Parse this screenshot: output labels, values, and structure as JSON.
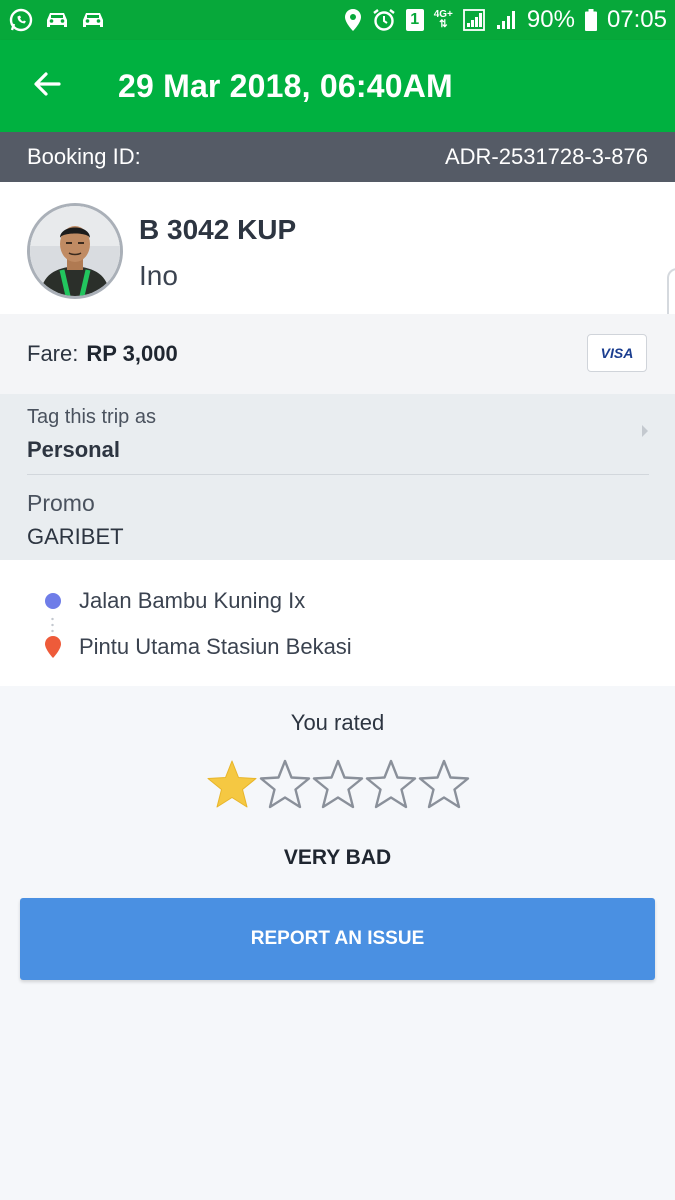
{
  "status_bar": {
    "battery": "90%",
    "time": "07:05",
    "sim_badge": "1",
    "network": "4G+"
  },
  "header": {
    "title": "29 Mar 2018, 06:40AM"
  },
  "booking": {
    "label": "Booking ID:",
    "id": "ADR-2531728-3-876"
  },
  "driver": {
    "plate": "B 3042 KUP",
    "name": "Ino"
  },
  "fare": {
    "label": "Fare:",
    "value": "RP 3,000",
    "card": "VISA"
  },
  "tag": {
    "label": "Tag this trip as",
    "value": "Personal"
  },
  "promo": {
    "label": "Promo",
    "value": "GARIBET"
  },
  "route": {
    "from": "Jalan Bambu Kuning Ix",
    "to": "Pintu Utama Stasiun Bekasi"
  },
  "rating": {
    "label": "You rated",
    "stars_filled": 1,
    "stars_total": 5,
    "verdict": "VERY BAD"
  },
  "actions": {
    "report": "REPORT AN ISSUE"
  },
  "colors": {
    "brand_green": "#00b140",
    "status_green": "#07a83a",
    "star_filled": "#f5c842",
    "button_blue": "#4a90e2"
  }
}
